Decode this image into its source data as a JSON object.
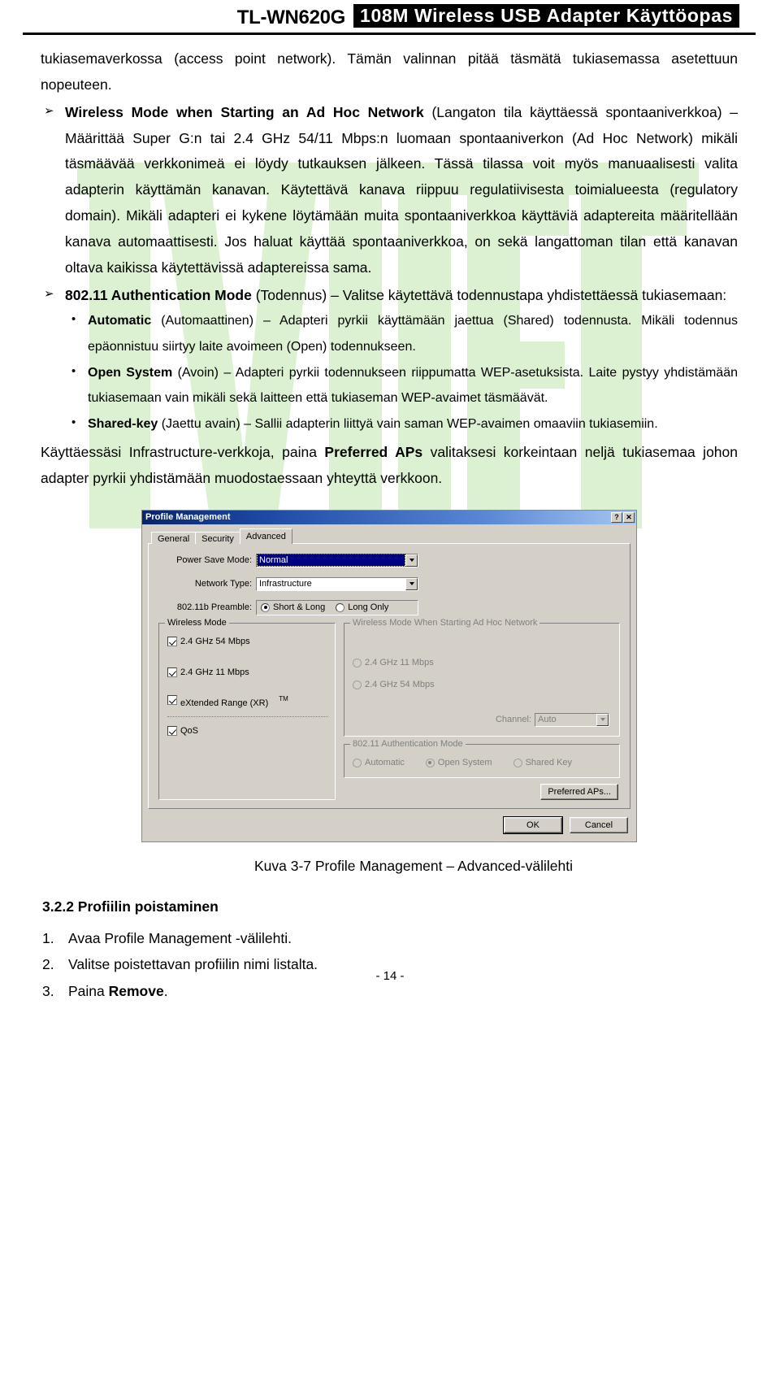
{
  "header": {
    "model": "TL-WN620G",
    "title": "108M Wireless USB Adapter Käyttöopas"
  },
  "body": {
    "intro_para": "tukiasemaverkossa (access point network). Tämän valinnan pitää täsmätä tukiasemassa asetettuun nopeuteen.",
    "arrow_marker": "➢",
    "bullet1": {
      "bold": "Wireless Mode when Starting an Ad Hoc Network",
      "rest": " (Langaton tila käyttäessä spontaaniverkkoa) – Määrittää Super G:n tai 2.4 GHz 54/11 Mbps:n luomaan spontaaniverkon (Ad Hoc Network) mikäli täsmäävää verkkonimeä ei löydy tutkauksen jälkeen. Tässä tilassa voit myös manuaalisesti valita adapterin käyttämän kanavan. Käytettävä kanava riippuu regulatiivisesta toimialueesta (regulatory domain). Mikäli adapteri ei kykene löytämään muita spontaaniverkkoa käyttäviä adaptereita määritellään kanava automaattisesti. Jos haluat käyttää spontaaniverkkoa, on sekä langattoman tilan että kanavan oltava kaikissa käytettävissä adaptereissa sama."
    },
    "bullet2": {
      "bold": "802.11 Authentication Mode",
      "rest": " (Todennus) – Valitse käytettävä todennustapa yhdistettäessä tukiasemaan:"
    },
    "sub_items": [
      {
        "bold": "Automatic",
        "rest": " (Automaattinen) – Adapteri pyrkii käyttämään jaettua (Shared) todennusta. Mikäli todennus epäonnistuu siirtyy laite avoimeen (Open) todennukseen."
      },
      {
        "bold": "Open System",
        "rest": " (Avoin) – Adapteri pyrkii todennukseen riippumatta WEP-asetuksista. Laite pystyy yhdistämään tukiasemaan vain mikäli sekä laitteen että tukiaseman WEP-avaimet täsmäävät."
      },
      {
        "bold": "Shared-key",
        "rest": " (Jaettu avain) – Sallii adapterin liittyä vain saman WEP-avaimen omaaviin tukiasemiin."
      }
    ],
    "tail_para": {
      "part1": "Käyttäessäsi Infrastructure-verkkoja, paina ",
      "bold": "Preferred APs",
      "part2": " valitaksesi korkeintaan neljä tukiasemaa johon adapter pyrkii yhdistämään muodostaessaan yhteyttä verkkoon."
    }
  },
  "dialog": {
    "title": "Profile Management",
    "help_button": "?",
    "close_button": "✕",
    "tabs": [
      {
        "label": "General",
        "active": false
      },
      {
        "label": "Security",
        "active": false
      },
      {
        "label": "Advanced",
        "active": true
      }
    ],
    "power_save_mode": {
      "label": "Power Save Mode:",
      "value": "Normal"
    },
    "network_type": {
      "label": "Network Type:",
      "value": "Infrastructure"
    },
    "preamble": {
      "label": "802.11b Preamble:",
      "options": [
        {
          "label": "Short & Long",
          "selected": true
        },
        {
          "label": "Long Only",
          "selected": false
        }
      ]
    },
    "wireless_mode": {
      "title": "Wireless Mode",
      "items": [
        {
          "label": "2.4 GHz 54 Mbps",
          "checked": true
        },
        {
          "label": "2.4 GHz 11 Mbps",
          "checked": true
        },
        {
          "label": "eXtended Range (XR)",
          "checked": true,
          "sup": "TM"
        },
        {
          "label": "QoS",
          "checked": true
        }
      ]
    },
    "adhoc_mode": {
      "title": "Wireless Mode When Starting Ad Hoc Network",
      "options": [
        {
          "label": "2.4 GHz 11 Mbps",
          "selected": false
        },
        {
          "label": "2.4 GHz 54 Mbps",
          "selected": false
        }
      ],
      "channel_label": "Channel:",
      "channel_value": "Auto"
    },
    "auth_mode": {
      "title": "802.11 Authentication Mode",
      "options": [
        {
          "label": "Automatic",
          "selected": false
        },
        {
          "label": "Open System",
          "selected": true
        },
        {
          "label": "Shared Key",
          "selected": false
        }
      ]
    },
    "preferred_aps_button": "Preferred APs...",
    "ok_button": "OK",
    "cancel_button": "Cancel"
  },
  "figure_caption": "Kuva 3-7    Profile Management – Advanced-välilehti",
  "section": {
    "heading": "3.2.2 Profiilin poistaminen",
    "steps": [
      {
        "num": "1.",
        "text": "Avaa Profile Management -välilehti.",
        "bold": ""
      },
      {
        "num": "2.",
        "text": "Valitse poistettavan profiilin nimi listalta.",
        "bold": ""
      },
      {
        "num": "3.",
        "text": "Paina ",
        "bold": "Remove",
        "after": "."
      }
    ]
  },
  "footer": "- 14 -",
  "colors": {
    "titlebar_dark": "#0a246a",
    "titlebar_light": "#a6c8f0",
    "dialog_face": "#d4d0c8",
    "selection": "#000080",
    "watermark_green": "#d9f0d0"
  }
}
